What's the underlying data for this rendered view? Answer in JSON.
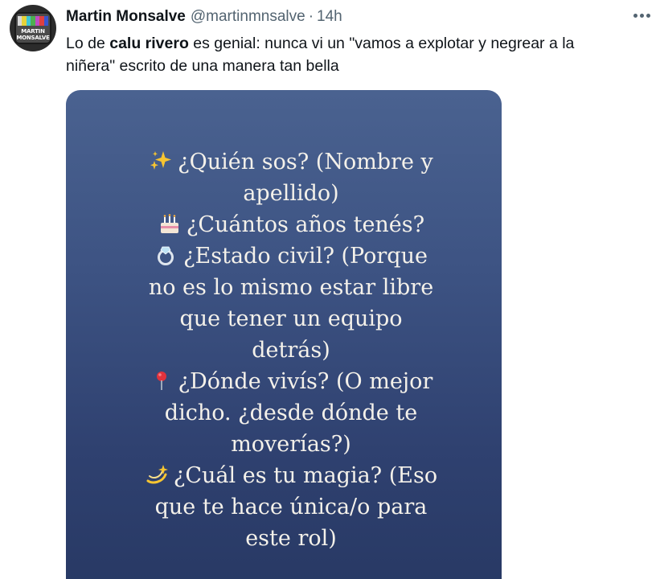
{
  "tweet": {
    "author": {
      "display_name": "Martin Monsalve",
      "handle": "@martinmnsalve",
      "separator": "·",
      "time": "14h",
      "avatar_text": "MARTIN MONSALVE"
    },
    "text": {
      "prefix": "Lo de ",
      "bold": "calu rivero",
      "suffix_line1": " es genial: nunca vi un \"vamos a explotar y negrear a la",
      "line2": "niñera\" escrito de una manera tan bella"
    },
    "more_icon": "more-horizontal-icon",
    "media": {
      "background": "#3d5383",
      "lines": [
        {
          "emoji": "sparkles-icon",
          "text": "¿Quién sos? (Nombre y"
        },
        {
          "emoji": "",
          "text": "apellido)"
        },
        {
          "emoji": "birthday-cake-icon",
          "text": "¿Cuántos años tenés?"
        },
        {
          "emoji": "ring-icon",
          "text": "¿Estado civil? (Porque"
        },
        {
          "emoji": "",
          "text": "no es lo mismo estar libre"
        },
        {
          "emoji": "",
          "text": "que tener un equipo"
        },
        {
          "emoji": "",
          "text": "detrás)"
        },
        {
          "emoji": "round-pushpin-icon",
          "text": "¿Dónde vivís? (O mejor"
        },
        {
          "emoji": "",
          "text": "dicho. ¿desde dónde te"
        },
        {
          "emoji": "",
          "text": "moverías?)"
        },
        {
          "emoji": "dizzy-icon",
          "text": "¿Cuál es tu magia? (Eso"
        },
        {
          "emoji": "",
          "text": "que te hace única/o para"
        },
        {
          "emoji": "",
          "text": "este rol)"
        }
      ]
    }
  }
}
